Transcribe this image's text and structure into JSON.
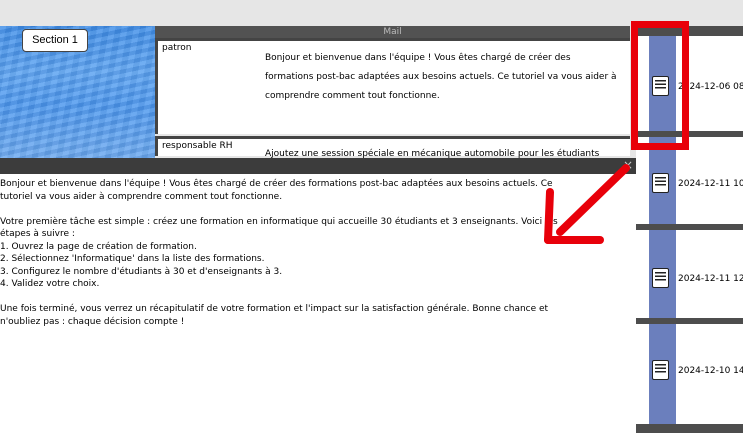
{
  "section": {
    "label": "Section 1"
  },
  "mail": {
    "header": "Mail",
    "rows": [
      {
        "sender": "patron",
        "text": "Bonjour et bienvenue dans l'équipe ! Vous êtes chargé de créer des formations post-bac adaptées aux besoins actuels. Ce tutoriel va vous aider à comprendre comment tout fonctionne."
      },
      {
        "sender": "responsable RH",
        "text": "Ajoutez une session spéciale en mécanique automobile pour les étudiants"
      }
    ]
  },
  "notifications": [
    {
      "date": "2024-12-06 08",
      "icon": "document-icon"
    },
    {
      "date": "2024-12-11 10",
      "icon": "document-icon"
    },
    {
      "date": "2024-12-11 12",
      "icon": "document-icon"
    },
    {
      "date": "2024-12-10 14",
      "icon": "document-icon"
    }
  ],
  "modal": {
    "close": "×",
    "lines": [
      "Bonjour et bienvenue dans l'équipe ! Vous êtes chargé de créer des formations post-bac adaptées aux besoins actuels. Ce",
      "tutoriel va vous aider à comprendre comment tout fonctionne.",
      "",
      "Votre première tâche est simple : créez une formation en informatique qui accueille 30 étudiants et 3 enseignants. Voici les",
      "étapes à suivre :",
      "1. Ouvrez la page de création de formation.",
      "2. Sélectionnez 'Informatique' dans la liste des formations.",
      "3. Configurez le nombre d'étudiants à 30 et d'enseignants à 3.",
      "4. Validez votre choix.",
      "",
      "Une fois terminé, vous verrez un récapitulatif de votre formation et l'impact sur la satisfaction générale. Bonne chance et",
      "n'oubliez pas : chaque décision compte !"
    ]
  },
  "colors": {
    "highlight": "#e8000a",
    "notif_strip": "#6b7fbd",
    "panel": "#4d4d4d"
  }
}
